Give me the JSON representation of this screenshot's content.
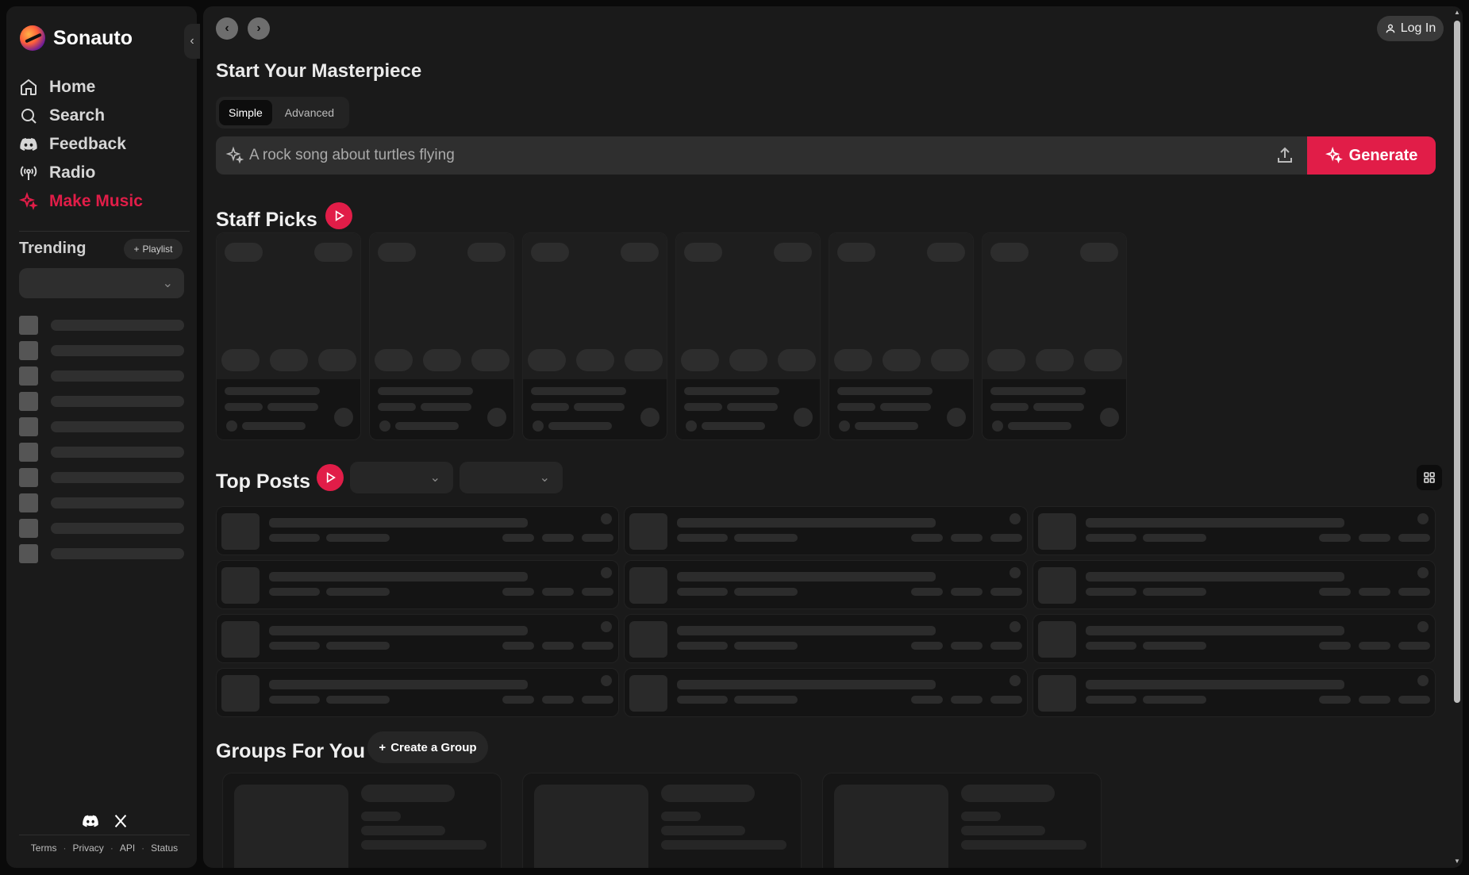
{
  "brand": {
    "name": "Sonauto"
  },
  "nav": [
    {
      "label": "Home",
      "icon": "home-icon"
    },
    {
      "label": "Search",
      "icon": "search-icon"
    },
    {
      "label": "Feedback",
      "icon": "discord-icon"
    },
    {
      "label": "Radio",
      "icon": "radio-icon"
    },
    {
      "label": "Make Music",
      "icon": "sparkle-icon",
      "active": true
    }
  ],
  "trending": {
    "title": "Trending",
    "playlist_label": "Playlist"
  },
  "footer": {
    "links": [
      "Terms",
      "Privacy",
      "API",
      "Status"
    ]
  },
  "header": {
    "login_label": "Log In"
  },
  "create": {
    "title": "Start Your Masterpiece",
    "tabs": [
      {
        "label": "Simple",
        "active": true
      },
      {
        "label": "Advanced",
        "active": false
      }
    ],
    "prompt_placeholder": "A rock song about turtles flying",
    "generate_label": "Generate"
  },
  "sections": {
    "staff_picks": "Staff Picks",
    "top_posts": "Top Posts",
    "groups": "Groups For You",
    "create_group": "Create a Group"
  },
  "colors": {
    "accent": "#e11d48",
    "background": "#1a1a1a",
    "page": "#0a0a0a"
  }
}
